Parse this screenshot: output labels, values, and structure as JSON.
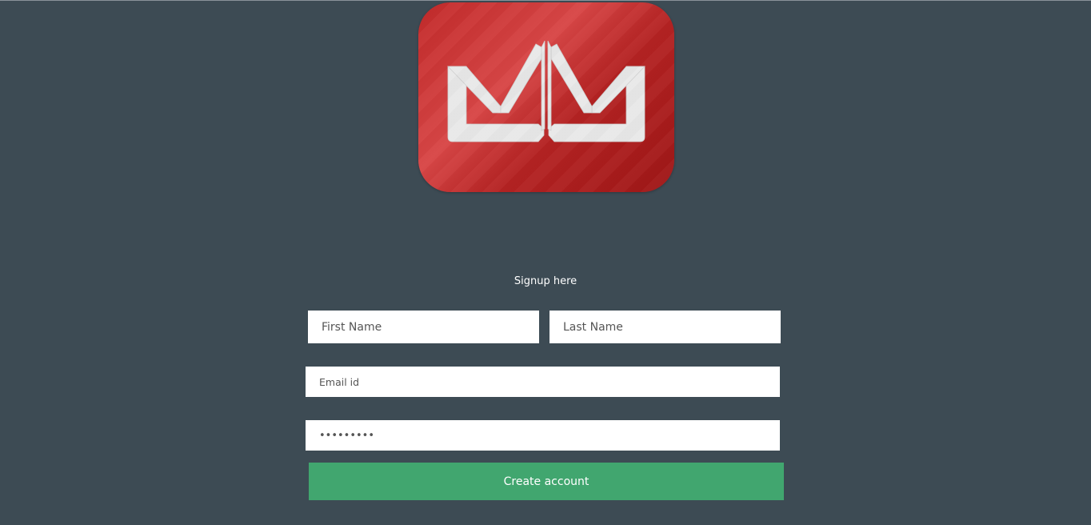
{
  "logo": {
    "icon": "mm-crown-logo",
    "background_color": "#c62c2c",
    "mark_color": "#e8e8e8"
  },
  "form": {
    "title": "Signup here",
    "first_name": {
      "placeholder": "First Name",
      "value": ""
    },
    "last_name": {
      "placeholder": "Last Name",
      "value": ""
    },
    "email": {
      "placeholder": "Email id",
      "value": ""
    },
    "password": {
      "placeholder": "",
      "value": "•••••••••"
    },
    "submit_label": "Create account"
  },
  "colors": {
    "page_background": "#3d4b54",
    "button_background": "#41a66f",
    "button_text": "#ffffff"
  }
}
